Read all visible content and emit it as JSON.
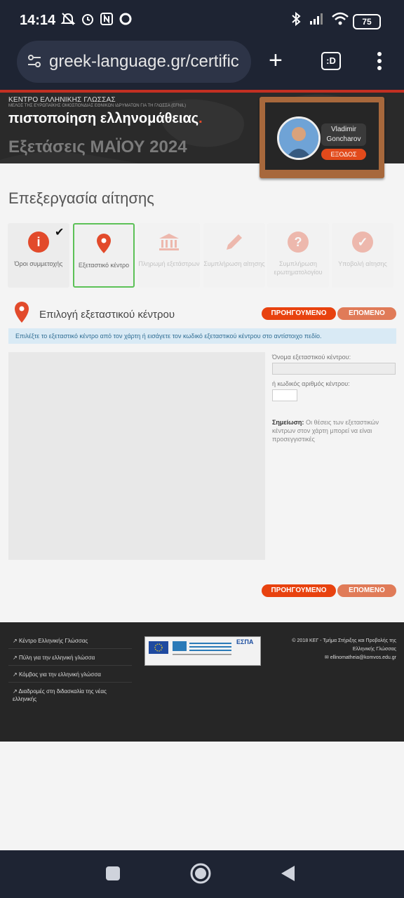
{
  "status_bar": {
    "time": "14:14",
    "battery": "75"
  },
  "browser": {
    "url": "greek-language.gr/certific",
    "plus": "+",
    "tabs_count": ":D"
  },
  "header": {
    "org": "ΚΕΝΤΡΟ ΕΛΛΗΝΙΚΗΣ ΓΛΩΣΣΑΣ",
    "org_sub": "ΜΕΛΟΣ ΤΗΣ ΕΥΡΩΠΑΪΚΗΣ ΟΜΟΣΠΟΝΔΙΑΣ ΕΘΝΙΚΩΝ ΙΔΡΥΜΑΤΩΝ ΓΙΑ ΤΗ ΓΛΩΣΣΑ (EFNIL)",
    "title": "πιστοποίηση ελληνομάθειας",
    "title_dot": ".",
    "exam": "Εξετάσεις ΜΑΪΟΥ 2024",
    "user_name": "Vladimir Goncharov",
    "logout": "ΕΞΟΔΟΣ"
  },
  "page": {
    "title": "Επεξεργασία αίτησης"
  },
  "steps": [
    {
      "label": "Όροι συμμετοχής",
      "icon": "info-icon",
      "color": "#e24a2b"
    },
    {
      "label": "Εξεταστικό κέντρο",
      "icon": "map-pin-icon",
      "color": "#e24a2b"
    },
    {
      "label": "Πληρωμή εξετάστρων",
      "icon": "bank-icon",
      "color": "#e24a2b"
    },
    {
      "label": "Συμπλήρωση αίτησης",
      "icon": "pencil-icon",
      "color": "#e24a2b"
    },
    {
      "label": "Συμπλήρωση ερωτηματολογίου",
      "icon": "question-icon",
      "color": "#e24a2b"
    },
    {
      "label": "Υποβολή αίτησης",
      "icon": "submit-check-icon",
      "color": "#e24a2b"
    }
  ],
  "section": {
    "title": "Επιλογή εξεταστικού κέντρου",
    "prev": "ΠΡΟΗΓΟΥΜΕΝΟ",
    "next": "ΕΠΟΜΕΝΟ",
    "info": "Επιλέξτε το εξεταστικό κέντρο από τον χάρτη ή εισάγετε τον κωδικό εξεταστικού κέντρου στο αντίστοιχο πεδίο.",
    "name_label": "Όνομα εξεταστικού κέντρου:",
    "code_label": "ή κωδικός αριθμός κέντρου:",
    "note_strong": "Σημείωση:",
    "note": "Οι θέσεις των εξεταστικών κέντρων στον χάρτη μπορεί να είναι προσεγγιστικές"
  },
  "footer": {
    "links": [
      "Κέντρο Ελληνικής Γλώσσας",
      "Πύλη για την ελληνική γλώσσα",
      "Κόμβος για την ελληνική γλώσσα",
      "Διαδρομές στη διδασκαλία της νέας ελληνικής"
    ],
    "espa": "ΕΣΠΑ",
    "copyright_1": "© 2018 ΚΕΓ - Τμήμα Στήριξης και Προβολής της Ελληνικής Γλώσσας",
    "email": "ellinomatheia@komvos.edu.gr"
  }
}
